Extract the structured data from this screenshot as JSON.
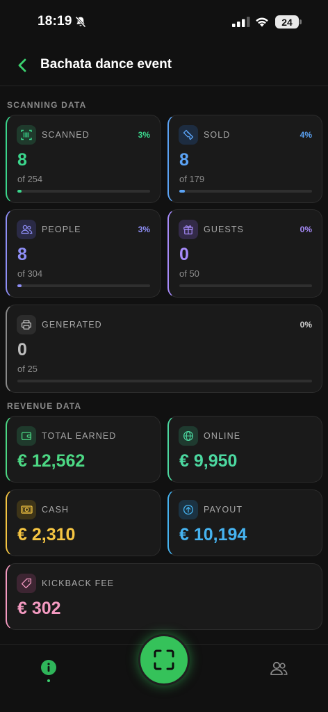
{
  "status_bar": {
    "time": "18:19",
    "battery": "24"
  },
  "header": {
    "title": "Bachata dance event"
  },
  "scanning": {
    "section_label": "SCANNING DATA",
    "cards": [
      {
        "key": "scanned",
        "label": "SCANNED",
        "pct": "3%",
        "value": "8",
        "of": "of 254",
        "progress": 0.03,
        "color": "#3bd68c",
        "icon": "barcode-icon"
      },
      {
        "key": "sold",
        "label": "SOLD",
        "pct": "4%",
        "value": "8",
        "of": "of 179",
        "progress": 0.04,
        "color": "#5ba3f5",
        "icon": "ticket-icon"
      },
      {
        "key": "people",
        "label": "PEOPLE",
        "pct": "3%",
        "value": "8",
        "of": "of 304",
        "progress": 0.03,
        "color": "#8f8ff7",
        "icon": "people-icon"
      },
      {
        "key": "guests",
        "label": "GUESTS",
        "pct": "0%",
        "value": "0",
        "of": "of 50",
        "progress": 0.0,
        "color": "#a78bfa",
        "icon": "gift-icon"
      },
      {
        "key": "generated",
        "label": "GENERATED",
        "pct": "0%",
        "value": "0",
        "of": "of 25",
        "progress": 0.0,
        "color": "#bdbdbd",
        "icon": "printer-icon"
      }
    ]
  },
  "revenue": {
    "section_label": "REVENUE DATA",
    "cards": [
      {
        "key": "total-earned",
        "label": "TOTAL EARNED",
        "value": "€ 12,562",
        "color": "#4cd884",
        "icon": "wallet-icon"
      },
      {
        "key": "online",
        "label": "ONLINE",
        "value": "€ 9,950",
        "color": "#4cd8a0",
        "icon": "globe-icon"
      },
      {
        "key": "cash",
        "label": "CASH",
        "value": "€ 2,310",
        "color": "#f5c542",
        "icon": "cash-icon"
      },
      {
        "key": "payout",
        "label": "PAYOUT",
        "value": "€ 10,194",
        "color": "#46b3f0",
        "icon": "arrow-up-circle-icon"
      },
      {
        "key": "kickback-fee",
        "label": "KICKBACK FEE",
        "value": "€ 302",
        "color": "#f49ac1",
        "icon": "tag-icon"
      }
    ]
  },
  "tab_bar": {
    "items": [
      "info-icon",
      "scan-icon",
      "people-icon"
    ],
    "accent": "#35c25a"
  }
}
